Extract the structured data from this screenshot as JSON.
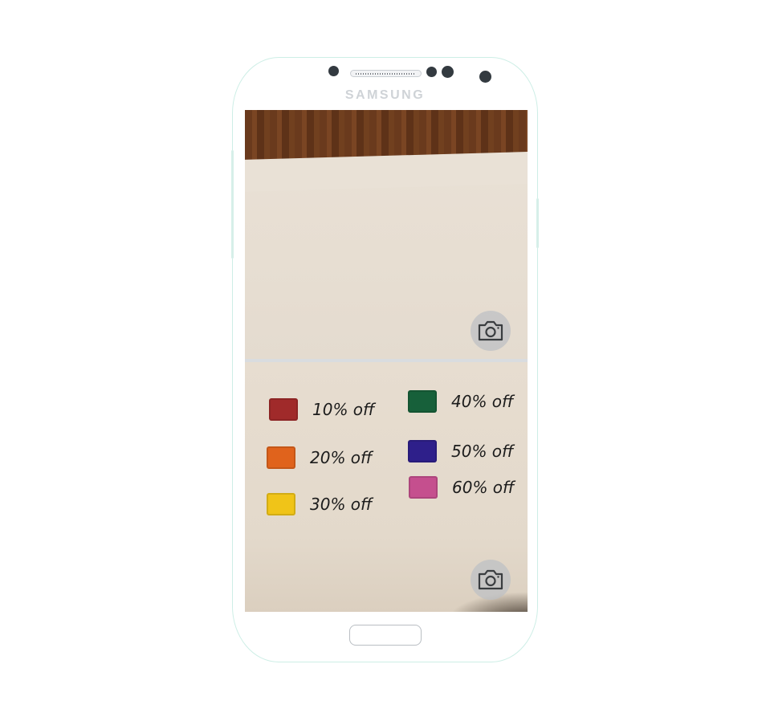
{
  "device": {
    "brand_label": "SAMSUNG"
  },
  "top_panel": {
    "camera_icon": "camera-icon"
  },
  "bottom_panel": {
    "camera_icon": "camera-icon",
    "legend_left": [
      {
        "color": "#a02a2a",
        "label": "10% off"
      },
      {
        "color": "#e0631c",
        "label": "20% off"
      },
      {
        "color": "#f0c418",
        "label": "30% off"
      }
    ],
    "legend_right": [
      {
        "color": "#17603a",
        "label": "40% off"
      },
      {
        "color": "#2e1f8a",
        "label": "50% off"
      },
      {
        "color": "#c54f8e",
        "label": "60% off"
      }
    ]
  }
}
